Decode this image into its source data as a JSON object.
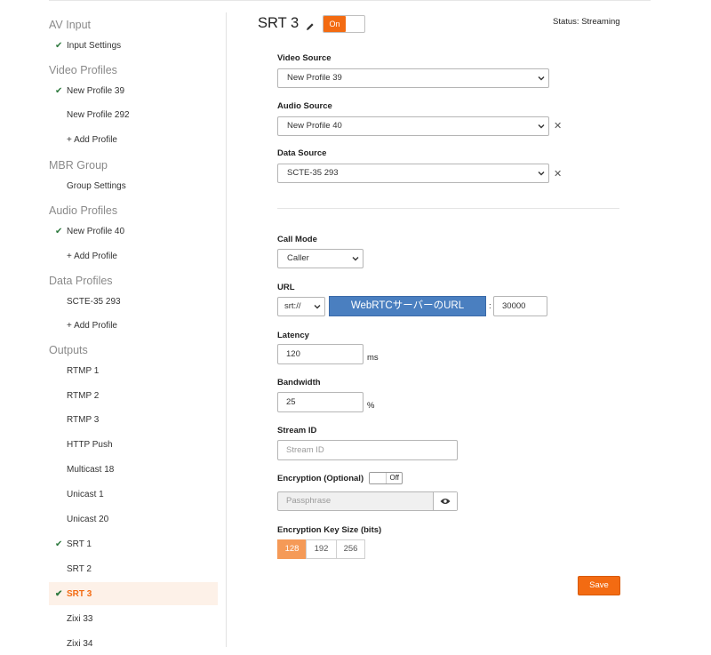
{
  "sidebar": {
    "sections": [
      {
        "label": "AV Input"
      },
      {
        "label": "Video Profiles"
      },
      {
        "label": "MBR Group"
      },
      {
        "label": "Audio Profiles"
      },
      {
        "label": "Data Profiles"
      },
      {
        "label": "Outputs"
      }
    ],
    "items": [
      {
        "label": "Input Settings",
        "checked": true
      },
      {
        "label": "New Profile 39",
        "checked": true
      },
      {
        "label": "New Profile 292",
        "checked": false
      },
      {
        "label": "+ Add Profile",
        "checked": false
      },
      {
        "label": "Group Settings",
        "checked": false
      },
      {
        "label": "New Profile 40",
        "checked": true
      },
      {
        "label": "+ Add Profile",
        "checked": false
      },
      {
        "label": "SCTE-35 293",
        "checked": false
      },
      {
        "label": "+ Add Profile",
        "checked": false
      },
      {
        "label": "RTMP 1",
        "checked": false
      },
      {
        "label": "RTMP 2",
        "checked": false
      },
      {
        "label": "RTMP 3",
        "checked": false
      },
      {
        "label": "HTTP Push",
        "checked": false
      },
      {
        "label": "Multicast 18",
        "checked": false
      },
      {
        "label": "Unicast 1",
        "checked": false
      },
      {
        "label": "Unicast 20",
        "checked": false
      },
      {
        "label": "SRT 1",
        "checked": true
      },
      {
        "label": "SRT 2",
        "checked": false
      },
      {
        "label": "SRT 3",
        "checked": true,
        "active": true
      },
      {
        "label": "Zixi 33",
        "checked": false
      },
      {
        "label": "Zixi 34",
        "checked": false
      }
    ]
  },
  "header": {
    "title": "SRT 3",
    "toggle_label": "On",
    "status": "Status: Streaming"
  },
  "form": {
    "video_source": {
      "label": "Video Source",
      "value": "New Profile 39"
    },
    "audio_source": {
      "label": "Audio Source",
      "value": "New Profile 40"
    },
    "data_source": {
      "label": "Data Source",
      "value": "SCTE-35 293"
    },
    "call_mode": {
      "label": "Call Mode",
      "value": "Caller"
    },
    "url": {
      "label": "URL",
      "protocol": "srt://",
      "host": "WebRTCサーバーのURL",
      "separator": ":",
      "port": "30000"
    },
    "latency": {
      "label": "Latency",
      "value": "120",
      "unit": "ms"
    },
    "bandwidth": {
      "label": "Bandwidth",
      "value": "25",
      "unit": "%"
    },
    "stream_id": {
      "label": "Stream ID",
      "placeholder": "Stream ID"
    },
    "encryption": {
      "label": "Encryption (Optional)",
      "toggle_label": "Off"
    },
    "passphrase": {
      "placeholder": "Passphrase"
    },
    "key_size": {
      "label": "Encryption Key Size (bits)",
      "options": [
        "128",
        "192",
        "256"
      ],
      "selected": "128"
    },
    "save_label": "Save"
  },
  "colors": {
    "accent": "#f36b12",
    "check": "#2f7a3f",
    "url_highlight": "#4a7fc0"
  }
}
